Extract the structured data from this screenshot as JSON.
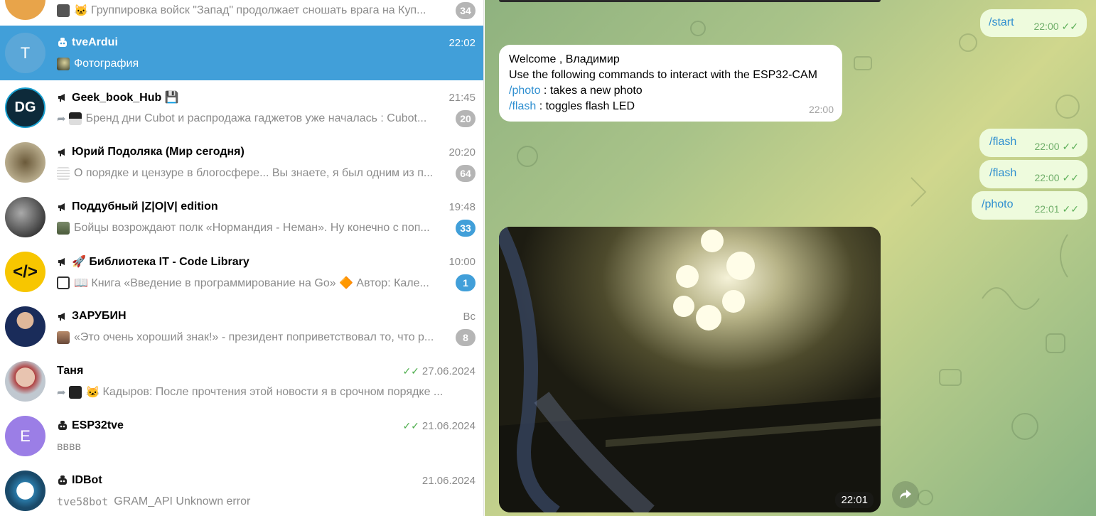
{
  "chats": [
    {
      "title": "",
      "time": "",
      "preview": "Группировка войск \"Запад\" продолжает сношать врага на Куп...",
      "badge": "34",
      "badge_style": "gray"
    },
    {
      "title": "tveArdui",
      "time": "22:02",
      "preview": "Фотография",
      "avatar_letter": "T",
      "avatar_color": "#5ba7d8",
      "active": true
    },
    {
      "title": "Geek_book_Hub 💾",
      "time": "21:45",
      "preview": "Бренд дни Cubot и распродажа гаджетов уже началась :  Cubot...",
      "badge": "20",
      "badge_style": "gray"
    },
    {
      "title": "Юрий Подоляка (Мир сегодня)",
      "time": "20:20",
      "preview": "О порядке и цензуре в блогосфере...  Вы знаете, я был одним из п...",
      "badge": "64",
      "badge_style": "gray"
    },
    {
      "title": "Поддубный |Z|O|V| edition",
      "time": "19:48",
      "preview": "Бойцы возрождают полк «Нормандия - Неман». Ну конечно с поп...",
      "badge": "33",
      "badge_style": "blue"
    },
    {
      "title": "🚀 Библиотека IT - Code Library",
      "time": "10:00",
      "preview": "📖 Книга «Введение в программирование на Go»  🔶 Автор: Кале...",
      "badge": "1",
      "badge_style": "blue"
    },
    {
      "title": "ЗАРУБИН",
      "time": "Вс",
      "preview": "«Это очень хороший знак!» - президент поприветствовал то, что р...",
      "badge": "8",
      "badge_style": "gray"
    },
    {
      "title": "Таня",
      "time": "27.06.2024",
      "preview": "Кадыров: После прочтения этой новости я в срочном порядке ...",
      "read": true
    },
    {
      "title": "ESP32tve",
      "time": "21.06.2024",
      "preview": "вввв",
      "avatar_letter": "E",
      "avatar_color": "#9b7ee6",
      "read": true
    },
    {
      "title": "IDBot",
      "time": "21.06.2024",
      "preview_code": "tve58bot",
      "preview": "GRAM_API Unknown error"
    }
  ],
  "messages": {
    "start": {
      "text": "/start",
      "time": "22:00"
    },
    "welcome": {
      "line1": "Welcome , Владимир",
      "line2": "Use the following commands to interact with the ESP32-CAM",
      "cmd1": "/photo",
      "desc1": " : takes a new photo",
      "cmd2": "/flash",
      "desc2": " : toggles flash LED",
      "time": "22:00"
    },
    "flash1": {
      "text": "/flash",
      "time": "22:00"
    },
    "flash2": {
      "text": "/flash",
      "time": "22:00"
    },
    "photo_cmd": {
      "text": "/photo",
      "time": "22:01"
    },
    "photo": {
      "time": "22:01"
    }
  },
  "colors": {
    "accent": "#419fd9",
    "badge_gray": "#b5b5b5",
    "read_tick": "#4fae4e"
  }
}
